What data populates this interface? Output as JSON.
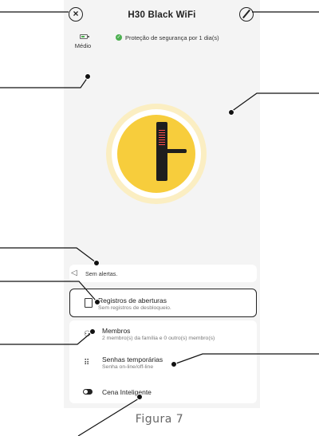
{
  "header": {
    "title": "H30 Black WiFi",
    "close_icon": "close-circle-icon",
    "edit_icon": "edit-pen-icon"
  },
  "status": {
    "battery_label": "Médio",
    "security_text": "Proteção de segurança por 1 dia(s)"
  },
  "device": {
    "illustration_icon": "smart-lock-icon",
    "accent_color": "#f7cd3c"
  },
  "alerts": {
    "text": "Sem alertas."
  },
  "records": {
    "title": "Registros de aberturas",
    "subtitle": "Sem registros de desbloqueio."
  },
  "members": {
    "title": "Membros",
    "subtitle": "2 membro(s) da família e 0 outro(s) membro(s)"
  },
  "temporary_passwords": {
    "title": "Senhas temporárias",
    "subtitle": "Senha on-line/off-line"
  },
  "smart_scene": {
    "title": "Cena Inteligente"
  },
  "caption": "Figura 7"
}
